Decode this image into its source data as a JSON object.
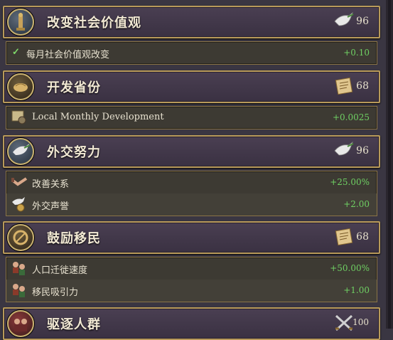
{
  "policies": [
    {
      "title": "改变社会价值观",
      "cost": "96",
      "cost_icon": "dove-icon",
      "icon": "statue-icon",
      "modifiers": [
        {
          "label": "每月社会价值观改变",
          "value": "+0.10",
          "icon": "checkmark-icon"
        }
      ]
    },
    {
      "title": "开发省份",
      "cost": "68",
      "cost_icon": "scroll-icon",
      "icon": "bread-icon",
      "modifiers": [
        {
          "label": "Local Monthly Development",
          "value": "+0.0025",
          "icon": "development-icon"
        }
      ]
    },
    {
      "title": "外交努力",
      "cost": "96",
      "cost_icon": "dove-icon",
      "icon": "dove-icon",
      "modifiers": [
        {
          "label": "改善关系",
          "value": "+25.00%",
          "icon": "handshake-icon"
        },
        {
          "label": "外交声誉",
          "value": "+2.00",
          "icon": "dove-coin-icon"
        }
      ]
    },
    {
      "title": "鼓励移民",
      "cost": "68",
      "cost_icon": "scroll-icon",
      "icon": "ring-icon",
      "modifiers": [
        {
          "label": "人口迁徙速度",
          "value": "+50.00%",
          "icon": "people-icon"
        },
        {
          "label": "移民吸引力",
          "value": "+1.00",
          "icon": "people-icon"
        }
      ]
    },
    {
      "title": "驱逐人群",
      "cost": "100",
      "cost_icon": "crossed-swords-icon",
      "icon": "crowd-icon",
      "modifiers": []
    }
  ],
  "colors": {
    "positive": "#6fd063",
    "frame_gold": "#b89a5a"
  }
}
